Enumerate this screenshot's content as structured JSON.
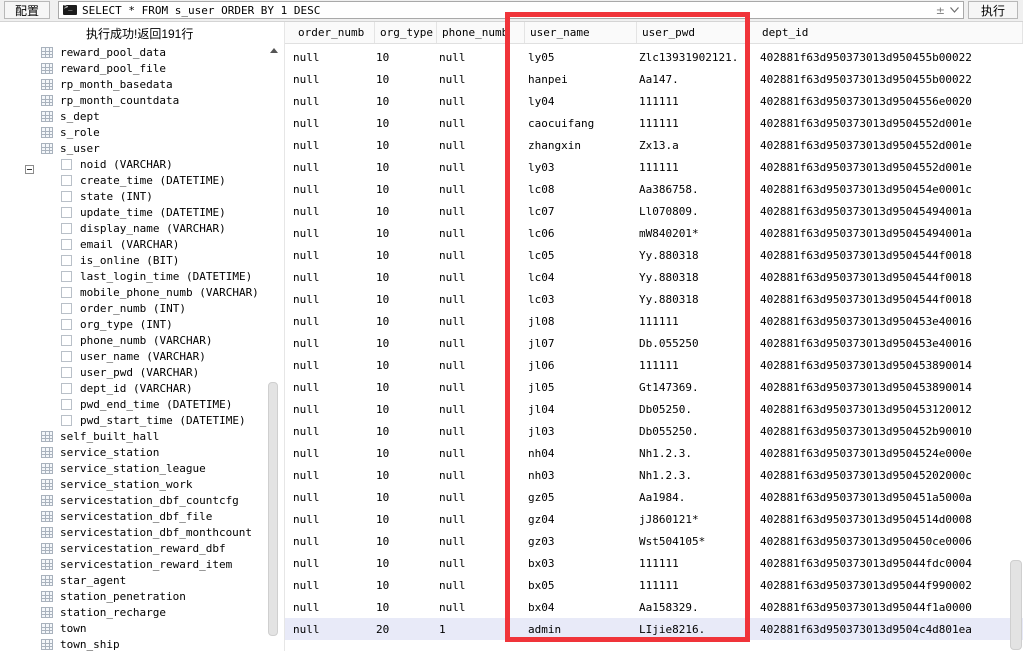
{
  "toolbar": {
    "config_label": "配置",
    "sql": "SELECT * FROM s_user ORDER BY 1 DESC",
    "dropdown_glyph": "±",
    "exec_label": "执行"
  },
  "tree": {
    "status": "执行成功!返回191行",
    "tables_before": [
      "reward_pool_data",
      "reward_pool_file",
      "rp_month_basedata",
      "rp_month_countdata",
      "s_dept",
      "s_role"
    ],
    "expanded_table": "s_user",
    "columns": [
      "noid (VARCHAR)",
      "create_time (DATETIME)",
      "state (INT)",
      "update_time (DATETIME)",
      "display_name (VARCHAR)",
      "email (VARCHAR)",
      "is_online (BIT)",
      "last_login_time (DATETIME)",
      "mobile_phone_numb (VARCHAR)",
      "order_numb (INT)",
      "org_type (INT)",
      "phone_numb (VARCHAR)",
      "user_name (VARCHAR)",
      "user_pwd (VARCHAR)",
      "dept_id (VARCHAR)",
      "pwd_end_time (DATETIME)",
      "pwd_start_time (DATETIME)"
    ],
    "tables_after": [
      "self_built_hall",
      "service_station",
      "service_station_league",
      "service_station_work",
      "servicestation_dbf_countcfg",
      "servicestation_dbf_file",
      "servicestation_dbf_monthcount",
      "servicestation_reward_dbf",
      "servicestation_reward_item",
      "star_agent",
      "station_penetration",
      "station_recharge",
      "town",
      "town_ship"
    ]
  },
  "grid": {
    "headers": [
      "order_numb",
      "org_type",
      "phone_numb",
      "user_name",
      "user_pwd",
      "dept_id"
    ],
    "rows": [
      [
        "null",
        "10",
        "null",
        "ly05",
        "Zlc13931902121.",
        "402881f63d950373013d950455b00022"
      ],
      [
        "null",
        "10",
        "null",
        "hanpei",
        "Aa147.",
        "402881f63d950373013d950455b00022"
      ],
      [
        "null",
        "10",
        "null",
        "ly04",
        "111111",
        "402881f63d950373013d9504556e0020"
      ],
      [
        "null",
        "10",
        "null",
        "caocuifang",
        "111111",
        "402881f63d950373013d9504552d001e"
      ],
      [
        "null",
        "10",
        "null",
        "zhangxin",
        "Zx13.a",
        "402881f63d950373013d9504552d001e"
      ],
      [
        "null",
        "10",
        "null",
        "ly03",
        "111111",
        "402881f63d950373013d9504552d001e"
      ],
      [
        "null",
        "10",
        "null",
        "lc08",
        "Aa386758.",
        "402881f63d950373013d950454e0001c"
      ],
      [
        "null",
        "10",
        "null",
        "lc07",
        "Ll070809.",
        "402881f63d950373013d95045494001a"
      ],
      [
        "null",
        "10",
        "null",
        "lc06",
        "mW840201*",
        "402881f63d950373013d95045494001a"
      ],
      [
        "null",
        "10",
        "null",
        "lc05",
        "Yy.880318",
        "402881f63d950373013d9504544f0018"
      ],
      [
        "null",
        "10",
        "null",
        "lc04",
        "Yy.880318",
        "402881f63d950373013d9504544f0018"
      ],
      [
        "null",
        "10",
        "null",
        "lc03",
        "Yy.880318",
        "402881f63d950373013d9504544f0018"
      ],
      [
        "null",
        "10",
        "null",
        "jl08",
        "111111",
        "402881f63d950373013d950453e40016"
      ],
      [
        "null",
        "10",
        "null",
        "jl07",
        "Db.055250",
        "402881f63d950373013d950453e40016"
      ],
      [
        "null",
        "10",
        "null",
        "jl06",
        "111111",
        "402881f63d950373013d950453890014"
      ],
      [
        "null",
        "10",
        "null",
        "jl05",
        "Gt147369.",
        "402881f63d950373013d950453890014"
      ],
      [
        "null",
        "10",
        "null",
        "jl04",
        "Db05250.",
        "402881f63d950373013d950453120012"
      ],
      [
        "null",
        "10",
        "null",
        "jl03",
        "Db055250.",
        "402881f63d950373013d950452b90010"
      ],
      [
        "null",
        "10",
        "null",
        "nh04",
        "Nh1.2.3.",
        "402881f63d950373013d9504524e000e"
      ],
      [
        "null",
        "10",
        "null",
        "nh03",
        "Nh1.2.3.",
        "402881f63d950373013d95045202000c"
      ],
      [
        "null",
        "10",
        "null",
        "gz05",
        "Aa1984.",
        "402881f63d950373013d950451a5000a"
      ],
      [
        "null",
        "10",
        "null",
        "gz04",
        "jJ860121*",
        "402881f63d950373013d9504514d0008"
      ],
      [
        "null",
        "10",
        "null",
        "gz03",
        "Wst504105*",
        "402881f63d950373013d950450ce0006"
      ],
      [
        "null",
        "10",
        "null",
        "bx03",
        "111111",
        "402881f63d950373013d95044fdc0004"
      ],
      [
        "null",
        "10",
        "null",
        "bx05",
        "111111",
        "402881f63d950373013d95044f990002"
      ],
      [
        "null",
        "10",
        "null",
        "bx04",
        "Aa158329.",
        "402881f63d950373013d95044f1a0000"
      ],
      [
        "null",
        "20",
        "1",
        "admin",
        "LIjie8216.",
        "402881f63d950373013d9504c4d801ea"
      ]
    ],
    "selected_row": 26,
    "highlight_color": "#f0343a"
  }
}
